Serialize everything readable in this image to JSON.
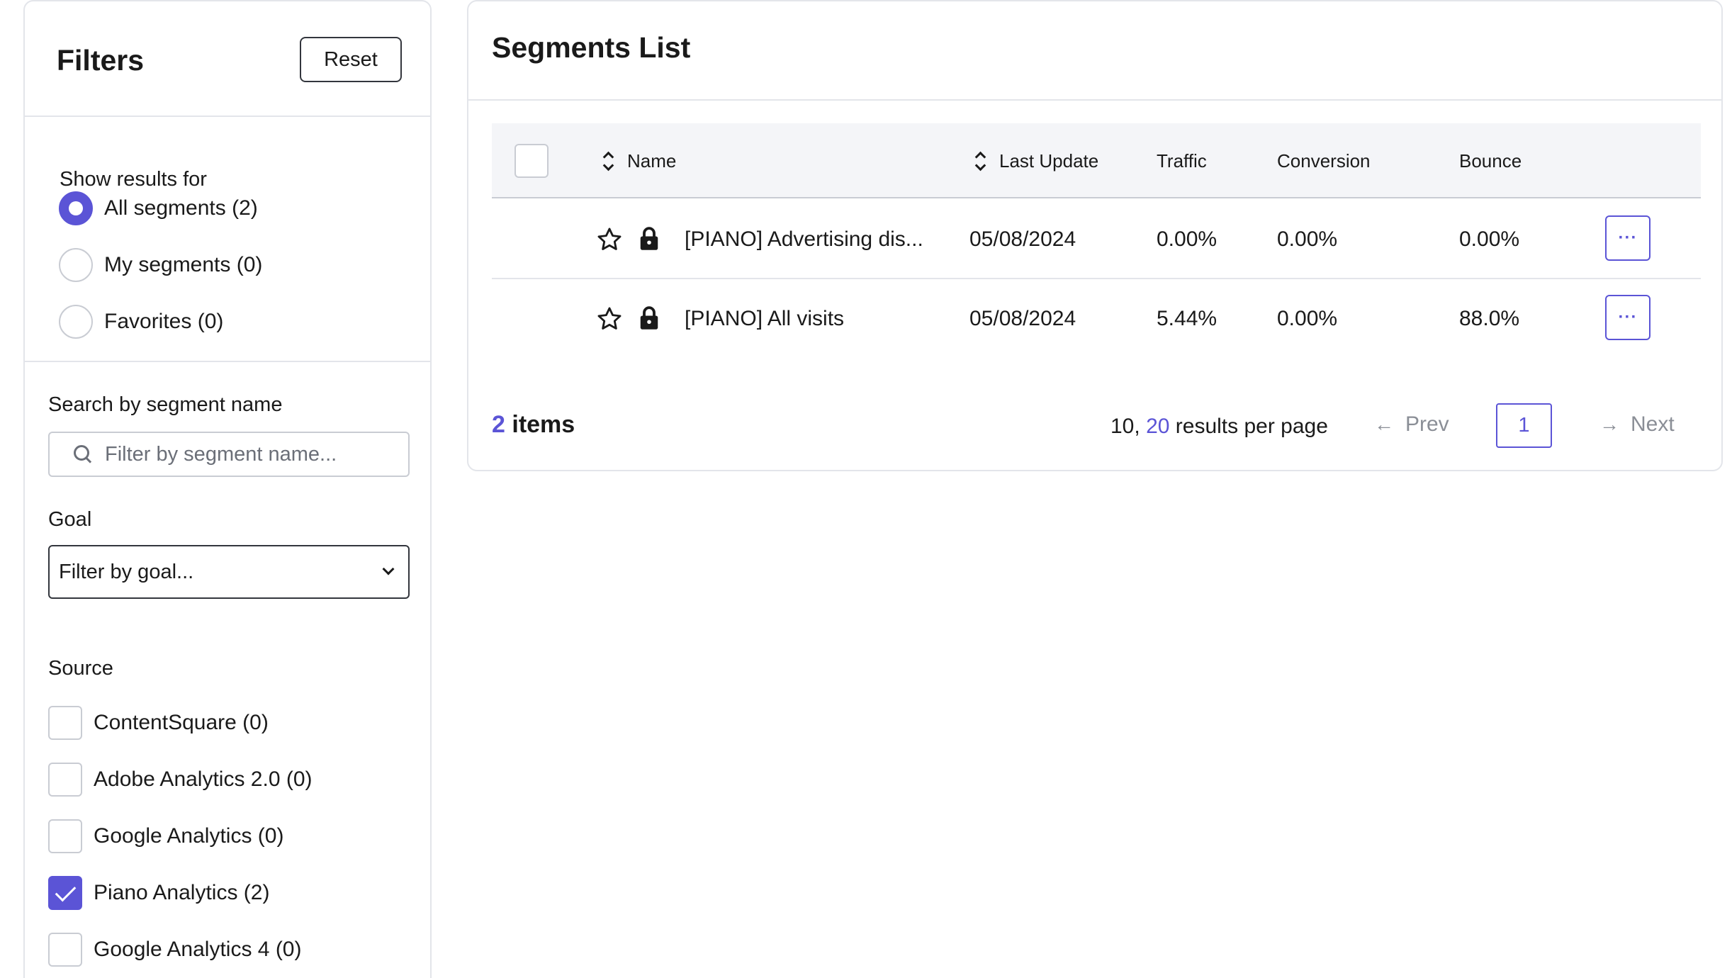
{
  "filters": {
    "title": "Filters",
    "reset_label": "Reset",
    "show_results_label": "Show results for",
    "options": [
      {
        "label": "All segments (2)",
        "checked": true
      },
      {
        "label": "My segments (0)",
        "checked": false
      },
      {
        "label": "Favorites (0)",
        "checked": false
      }
    ],
    "search_label": "Search by segment name",
    "search_placeholder": "Filter by segment name...",
    "search_value": "",
    "goal_label": "Goal",
    "goal_value": "Filter by goal...",
    "source_label": "Source",
    "sources": [
      {
        "label": "ContentSquare (0)",
        "checked": false
      },
      {
        "label": "Adobe Analytics 2.0 (0)",
        "checked": false
      },
      {
        "label": "Google Analytics (0)",
        "checked": false
      },
      {
        "label": "Piano Analytics (2)",
        "checked": true
      },
      {
        "label": "Google Analytics 4 (0)",
        "checked": false
      }
    ]
  },
  "segments": {
    "title": "Segments List",
    "columns": {
      "name": "Name",
      "last_update": "Last Update",
      "traffic": "Traffic",
      "conversion": "Conversion",
      "bounce": "Bounce"
    },
    "rows": [
      {
        "name": "[PIANO] Advertising dis...",
        "last_update": "05/08/2024",
        "traffic": "0.00%",
        "conversion": "0.00%",
        "bounce": "0.00%",
        "more": "···"
      },
      {
        "name": "[PIANO] All visits",
        "last_update": "05/08/2024",
        "traffic": "5.44%",
        "conversion": "0.00%",
        "bounce": "88.0%",
        "more": "···"
      }
    ],
    "footer": {
      "count": "2",
      "items_word": "items",
      "per_page_option_1": "10,",
      "per_page_option_2": "20",
      "per_page_suffix": "results per page",
      "prev_label": "Prev",
      "current_page": "1",
      "next_label": "Next",
      "arrow_left": "←",
      "arrow_right": "→"
    }
  },
  "colors": {
    "accent": "#5b54d6",
    "border": "#e3e5ea",
    "muted": "#8a8e96"
  }
}
